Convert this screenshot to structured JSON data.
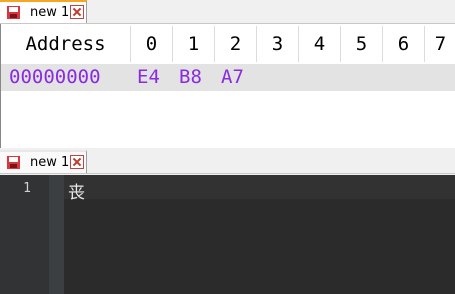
{
  "top_tab": {
    "label": "new 1"
  },
  "bottom_tab": {
    "label": "new 1"
  },
  "hex": {
    "header": {
      "address": "Address",
      "columns": [
        "0",
        "1",
        "2",
        "3",
        "4",
        "5",
        "6",
        "7"
      ]
    },
    "row": {
      "address": "00000000",
      "bytes": [
        "E4",
        "B8",
        "A7"
      ]
    }
  },
  "editor": {
    "line_number": "1",
    "line_text": "丧"
  },
  "icons": {
    "tab_icon": "floppy-disk-icon",
    "close": "close-icon"
  },
  "colors": {
    "hex_text": "#8a2be2",
    "tab_accent": "#f5a623",
    "editor_bg": "#2b2b2b"
  }
}
